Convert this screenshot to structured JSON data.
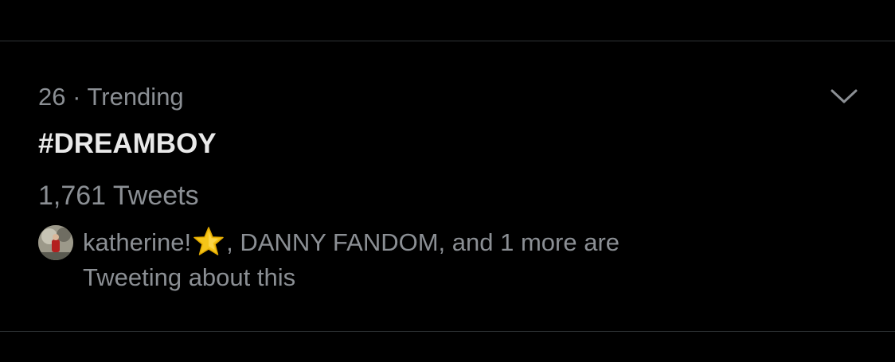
{
  "trend": {
    "context": "26 · Trending",
    "hashtag": "#DREAMBOY",
    "tweet_count": "1,761 Tweets",
    "social_context": {
      "user_name": "katherine!",
      "emoji_icon": "star-emoji-icon",
      "rest_line1": ", DANNY FANDOM, and 1 more are",
      "line2": "Tweeting about this"
    }
  },
  "colors": {
    "background": "#000000",
    "divider": "#2f3336",
    "secondary_text": "#8b8f94",
    "primary_text": "#e9e9e9",
    "star": "#f5c518"
  }
}
